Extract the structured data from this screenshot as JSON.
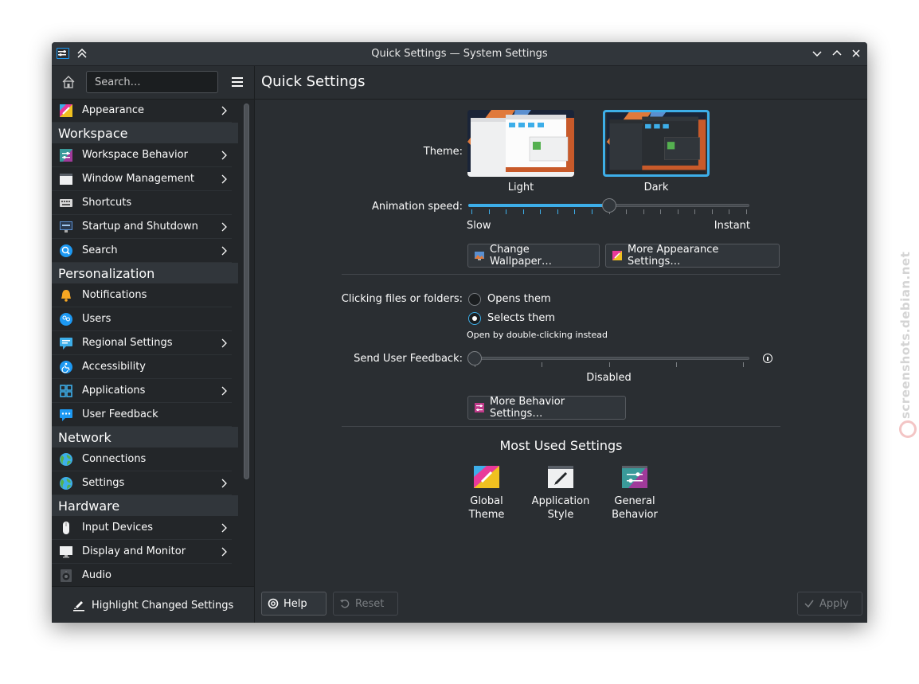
{
  "window": {
    "title": "Quick Settings — System Settings"
  },
  "sidebar": {
    "search_placeholder": "Search…",
    "items": [
      {
        "label": "Appearance",
        "icon": "appearance-icon",
        "arrow": true
      },
      {
        "category": "Workspace"
      },
      {
        "label": "Workspace Behavior",
        "icon": "workspace-behavior-icon",
        "arrow": true
      },
      {
        "label": "Window Management",
        "icon": "window-management-icon",
        "arrow": true
      },
      {
        "label": "Shortcuts",
        "icon": "keyboard-icon",
        "arrow": false
      },
      {
        "label": "Startup and Shutdown",
        "icon": "startup-icon",
        "arrow": true
      },
      {
        "label": "Search",
        "icon": "search-icon",
        "arrow": true
      },
      {
        "category": "Personalization"
      },
      {
        "label": "Notifications",
        "icon": "bell-icon",
        "arrow": false
      },
      {
        "label": "Users",
        "icon": "users-icon",
        "arrow": false
      },
      {
        "label": "Regional Settings",
        "icon": "regional-icon",
        "arrow": true
      },
      {
        "label": "Accessibility",
        "icon": "accessibility-icon",
        "arrow": false
      },
      {
        "label": "Applications",
        "icon": "applications-icon",
        "arrow": true
      },
      {
        "label": "User Feedback",
        "icon": "feedback-icon",
        "arrow": false
      },
      {
        "category": "Network"
      },
      {
        "label": "Connections",
        "icon": "globe-icon",
        "arrow": false
      },
      {
        "label": "Settings",
        "icon": "globe-icon",
        "arrow": true
      },
      {
        "category": "Hardware"
      },
      {
        "label": "Input Devices",
        "icon": "mouse-icon",
        "arrow": true
      },
      {
        "label": "Display and Monitor",
        "icon": "monitor-icon",
        "arrow": true
      },
      {
        "label": "Audio",
        "icon": "speaker-icon",
        "arrow": false
      }
    ],
    "highlight_label": "Highlight Changed Settings"
  },
  "main": {
    "title": "Quick Settings",
    "theme_label": "Theme:",
    "themes": [
      {
        "caption": "Light",
        "selected": false
      },
      {
        "caption": "Dark",
        "selected": true
      }
    ],
    "animation_label": "Animation speed:",
    "animation_level_fraction": 0.5,
    "slow_label": "Slow",
    "instant_label": "Instant",
    "change_wallpaper": "Change Wallpaper…",
    "more_appearance": "More Appearance Settings…",
    "clicking_label": "Clicking files or folders:",
    "opens_them": "Opens them",
    "selects_them": "Selects them",
    "selected_option": "Selects them",
    "double_click_note": "Open by double-clicking instead",
    "feedback_label": "Send User Feedback:",
    "feedback_value": "Disabled",
    "feedback_level_fraction": 0,
    "more_behavior": "More Behavior Settings…",
    "most_used_title": "Most Used Settings",
    "most_used": [
      {
        "label": "Global\nTheme",
        "icon": "global-theme-icon"
      },
      {
        "label": "Application\nStyle",
        "icon": "application-style-icon"
      },
      {
        "label": "General\nBehavior",
        "icon": "general-behavior-icon"
      }
    ],
    "help": "Help",
    "reset": "Reset",
    "apply": "Apply"
  },
  "watermark": {
    "text": "screenshots.debian.net"
  },
  "colors": {
    "accent": "#3daee9",
    "window_bg": "#2a2e32",
    "sidebar_bg": "#232629"
  }
}
